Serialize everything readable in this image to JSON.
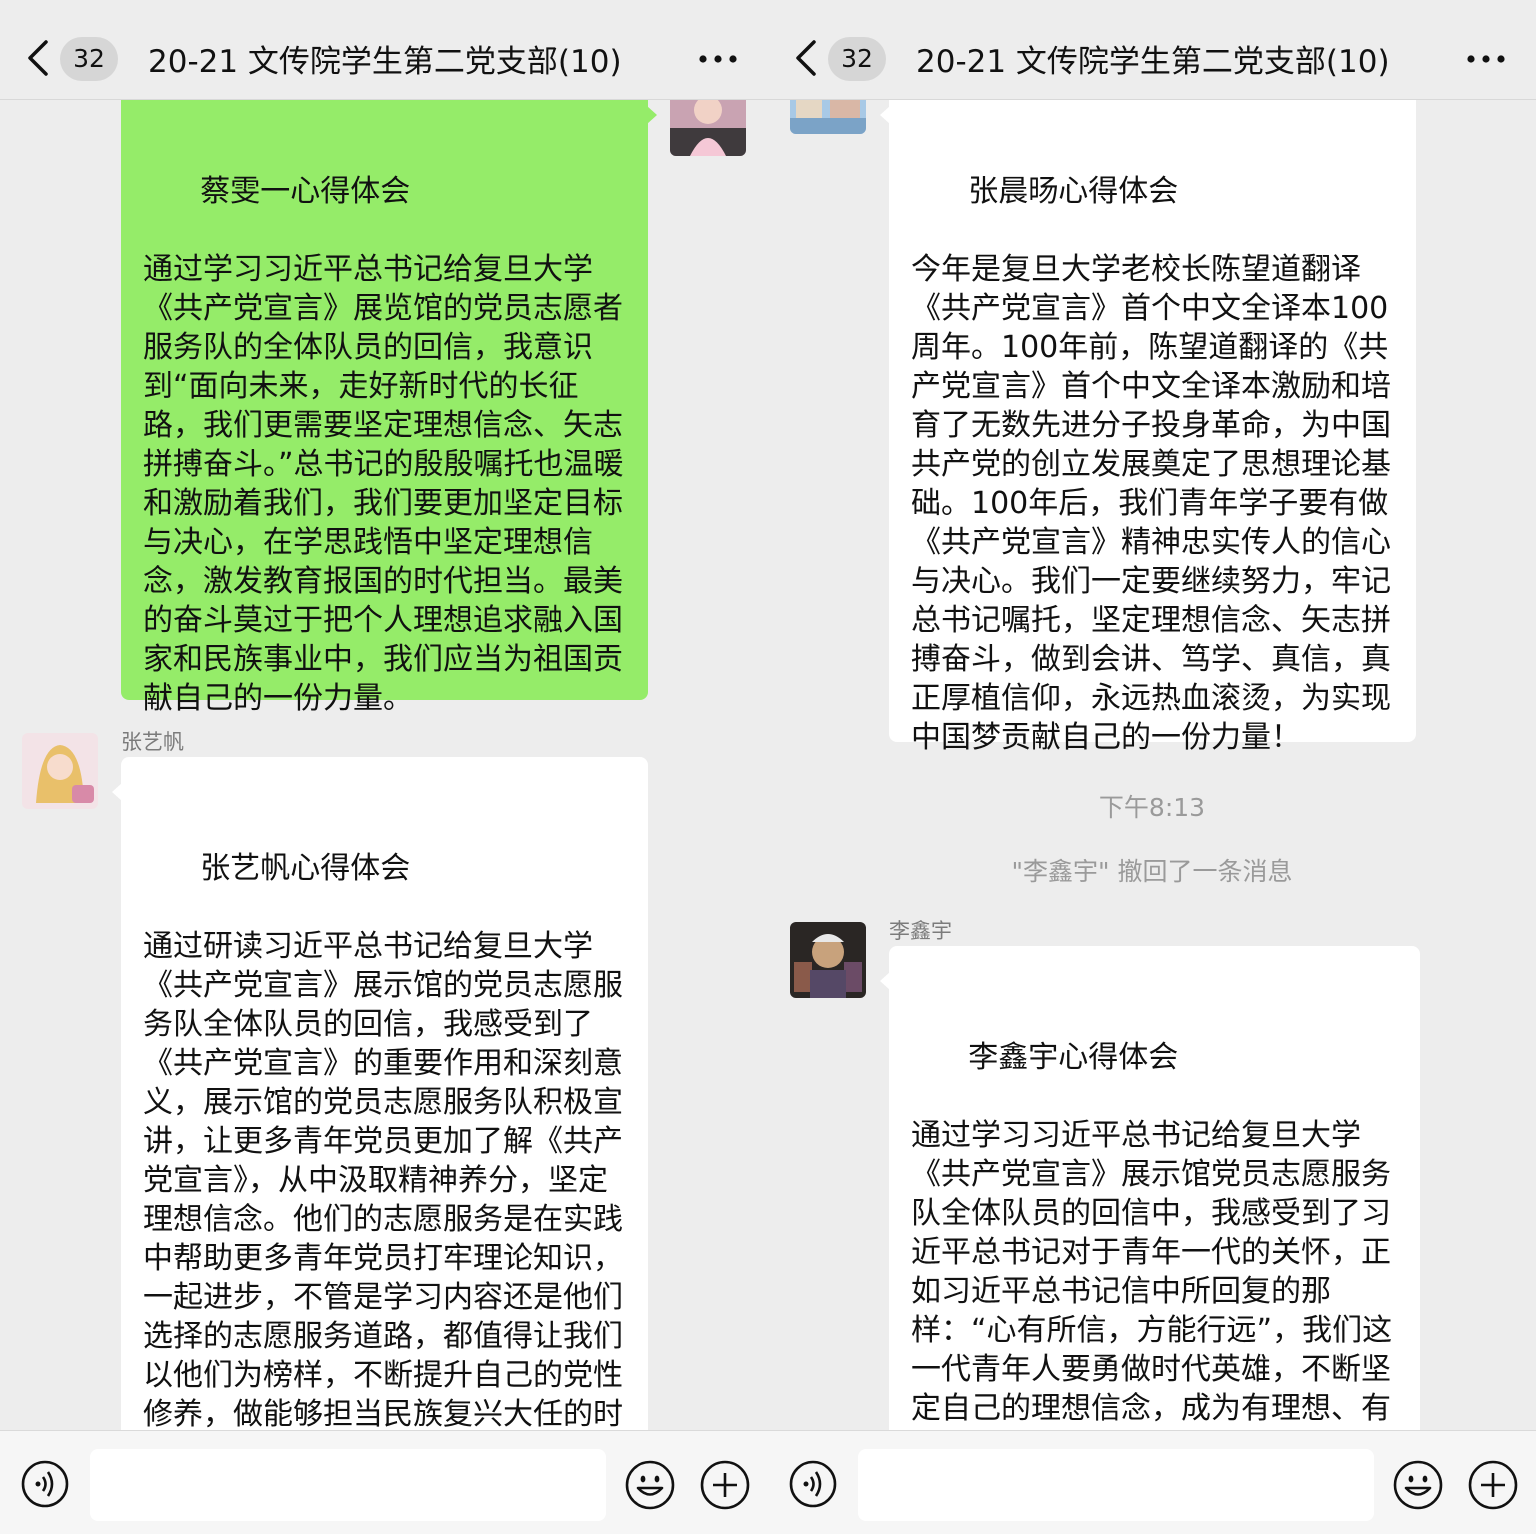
{
  "left": {
    "header": {
      "badge": "32",
      "title": "20-21 文传院学生第二党支部(10)"
    },
    "messages": {
      "self_message": "蔡雯一心得体会\n\n通过学习习近平总书记给复旦大学《共产党宣言》展览馆的党员志愿者服务队的全体队员的回信，我意识到“面向未来，走好新时代的长征路，我们更需要坚定理想信念、矢志拼搏奋斗。”总书记的殷殷嘱托也温暖和激励着我们，我们要更加坚定目标与决心，在学思践悟中坚定理想信念，激发教育报国的时代担当。最美的奋斗莫过于把个人理想追求融入国家和民族事业中，我们应当为祖国贡献自己的一份力量。",
      "sender_name": "张艺帆",
      "received_message": "张艺帆心得体会\n\n通过研读习近平总书记给复旦大学《共产党宣言》展示馆的党员志愿服务队全体队员的回信，我感受到了《共产党宣言》的重要作用和深刻意义，展示馆的党员志愿服务队积极宣讲，让更多青年党员更加了解《共产党宣言》，从中汲取精神养分，坚定理想信念。他们的志愿服务是在实践中帮助更多青年党员打牢理论知识，一起进步，不管是学习内容还是他们选择的志愿服务道路，都值得让我们以他们为榜样，不断提升自己的党性修养，做能够担当民族复兴大任的时代新人。"
    }
  },
  "right": {
    "header": {
      "badge": "32",
      "title": "20-21 文传院学生第二党支部(10)"
    },
    "messages": {
      "top_message": "张晨旸心得体会\n\n今年是复旦大学老校长陈望道翻译《共产党宣言》首个中文全译本100周年。100年前，陈望道翻译的《共产党宣言》首个中文全译本激励和培育了无数先进分子投身革命，为中国共产党的创立发展奠定了思想理论基础。100年后，我们青年学子要有做《共产党宣言》精神忠实传人的信心与决心。我们一定要继续努力，牢记总书记嘱托，坚定理想信念、矢志拼搏奋斗，做到会讲、笃学、真信，真正厚植信仰，永远热血滚烫，为实现中国梦贡献自己的一份力量！",
      "time": "下午8:13",
      "recall_notice": "\"李鑫宇\" 撤回了一条消息",
      "sender_name": "李鑫宇",
      "received_message": "李鑫宇心得体会\n\n通过学习习近平总书记给复旦大学《共产党宣言》展示馆党员志愿服务队全体队员的回信中，我感受到了习近平总书记对于青年一代的关怀，正如习近平总书记信中所回复的那样：“心有所信，方能行远”，我们这一代青年人要勇做时代英雄，不断坚定自己的理想信念，成为有理想、有本领、有担当的一代。"
    }
  },
  "colors": {
    "self_bubble": "#95ec69",
    "other_bubble": "#ffffff",
    "background": "#ededed"
  },
  "icons": [
    "back-arrow-icon",
    "more-icon",
    "voice-icon",
    "emoji-icon",
    "plus-icon"
  ]
}
